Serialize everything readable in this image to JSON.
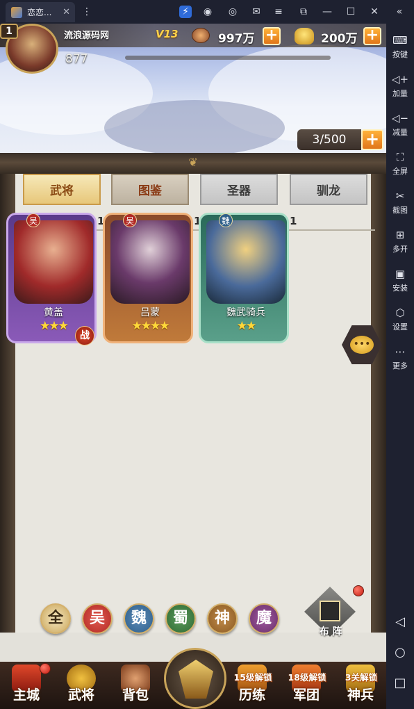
{
  "emulator": {
    "tab_title": "恋恋...",
    "sidebar": [
      {
        "label": "按键",
        "icon": "keyboard-icon",
        "glyph": "⌨"
      },
      {
        "label": "加量",
        "icon": "volume-up-icon",
        "glyph": "🔊"
      },
      {
        "label": "减量",
        "icon": "volume-down-icon",
        "glyph": "🔉"
      },
      {
        "label": "全屏",
        "icon": "fullscreen-icon",
        "glyph": "⛶"
      },
      {
        "label": "截图",
        "icon": "scissors-icon",
        "glyph": "✂"
      },
      {
        "label": "多开",
        "icon": "multi-window-icon",
        "glyph": "⊞"
      },
      {
        "label": "安装",
        "icon": "apk-install-icon",
        "glyph": "▣"
      },
      {
        "label": "设置",
        "icon": "settings-icon",
        "glyph": "⬡"
      },
      {
        "label": "更多",
        "icon": "more-icon",
        "glyph": "⋯"
      }
    ]
  },
  "player": {
    "level": "1",
    "name": "流浪源码网",
    "vip": "V13",
    "power": "877",
    "copper": "997万",
    "gold": "200万"
  },
  "capacity": "3/500",
  "tabs": [
    "武将",
    "图鉴",
    "圣器",
    "驯龙"
  ],
  "cards": [
    {
      "name": "黄盖",
      "kingdom": "吴",
      "count": "1",
      "stars": "★★★",
      "battle": "战",
      "theme": "purple"
    },
    {
      "name": "吕蒙",
      "kingdom": "吴",
      "count": "1",
      "stars": "★★★★",
      "battle": "",
      "theme": "orange"
    },
    {
      "name": "魏武骑兵",
      "kingdom": "魏",
      "count": "1",
      "stars": "★★",
      "battle": "",
      "theme": "green"
    }
  ],
  "factions": [
    "全",
    "吴",
    "魏",
    "蜀",
    "神",
    "魔"
  ],
  "formation_label": "布 阵",
  "nav": [
    {
      "label": "主城",
      "lock": ""
    },
    {
      "label": "武将",
      "lock": ""
    },
    {
      "label": "背包",
      "lock": ""
    },
    {
      "label": "",
      "lock": ""
    },
    {
      "label": "历练",
      "lock": "15级解锁"
    },
    {
      "label": "军团",
      "lock": "18级解锁"
    },
    {
      "label": "神兵",
      "lock": "3关解锁"
    }
  ],
  "colors": {
    "wu": "#b22a24",
    "wei": "#2e5f8a",
    "shu": "#2e6a34",
    "shen": "#8a5a22",
    "mo": "#6a2e6a",
    "all": "#c9a55a"
  }
}
